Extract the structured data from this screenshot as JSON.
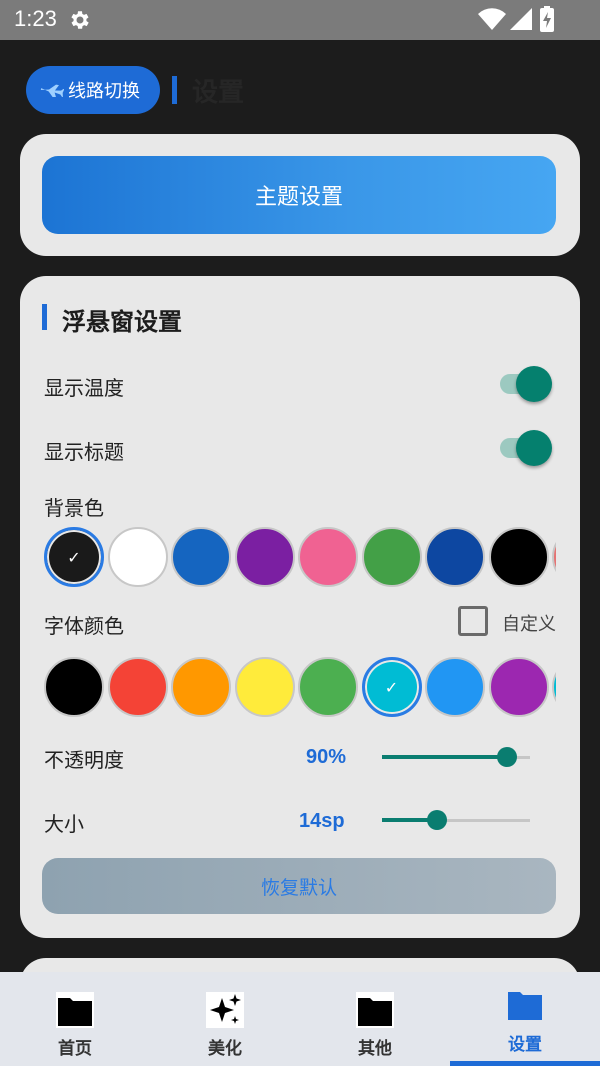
{
  "status_bar": {
    "time": "1:23",
    "icons": [
      "gear-icon",
      "wifi-icon",
      "signal-icon",
      "battery-charging-icon"
    ]
  },
  "header": {
    "route_button": "线路切换",
    "route_icon": "plane-icon",
    "title": "设置"
  },
  "theme_card": {
    "button": "主题设置"
  },
  "float_card": {
    "title": "浮悬窗设置",
    "show_temperature": {
      "label": "显示温度",
      "on": true
    },
    "show_title": {
      "label": "显示标题",
      "on": true
    },
    "background_color": {
      "label": "背景色",
      "swatches": [
        "#1a1a1a",
        "#ffffff",
        "#1565c0",
        "#7b1fa2",
        "#f06292",
        "#43a047",
        "#0d47a1",
        "#000000",
        "#e57373"
      ],
      "selected_index": 0
    },
    "font_color": {
      "label": "字体颜色",
      "custom_label": "自定义",
      "custom_checked": false,
      "swatches": [
        "#000000",
        "#f44336",
        "#ff9800",
        "#ffeb3b",
        "#4caf50",
        "#00bcd4",
        "#2196f3",
        "#9c27b0",
        "#00bcd4"
      ],
      "selected_index": 5
    },
    "opacity": {
      "label": "不透明度",
      "value": "90%",
      "fraction": 0.9
    },
    "size": {
      "label": "大小",
      "value": "14sp",
      "fraction": 0.35
    },
    "reset_button": "恢复默认"
  },
  "bottom_nav": {
    "items": [
      {
        "label": "首页",
        "icon": "folder-icon"
      },
      {
        "label": "美化",
        "icon": "sparkle-icon"
      },
      {
        "label": "其他",
        "icon": "folder-icon"
      },
      {
        "label": "设置",
        "icon": "folder-icon"
      }
    ],
    "active_index": 3
  },
  "colors": {
    "accent": "#1e6bd6",
    "toggle_on": "#05806e",
    "slider": "#0a7d70",
    "card_bg": "#e8e8e8",
    "page_bg": "#1c1c1c"
  }
}
